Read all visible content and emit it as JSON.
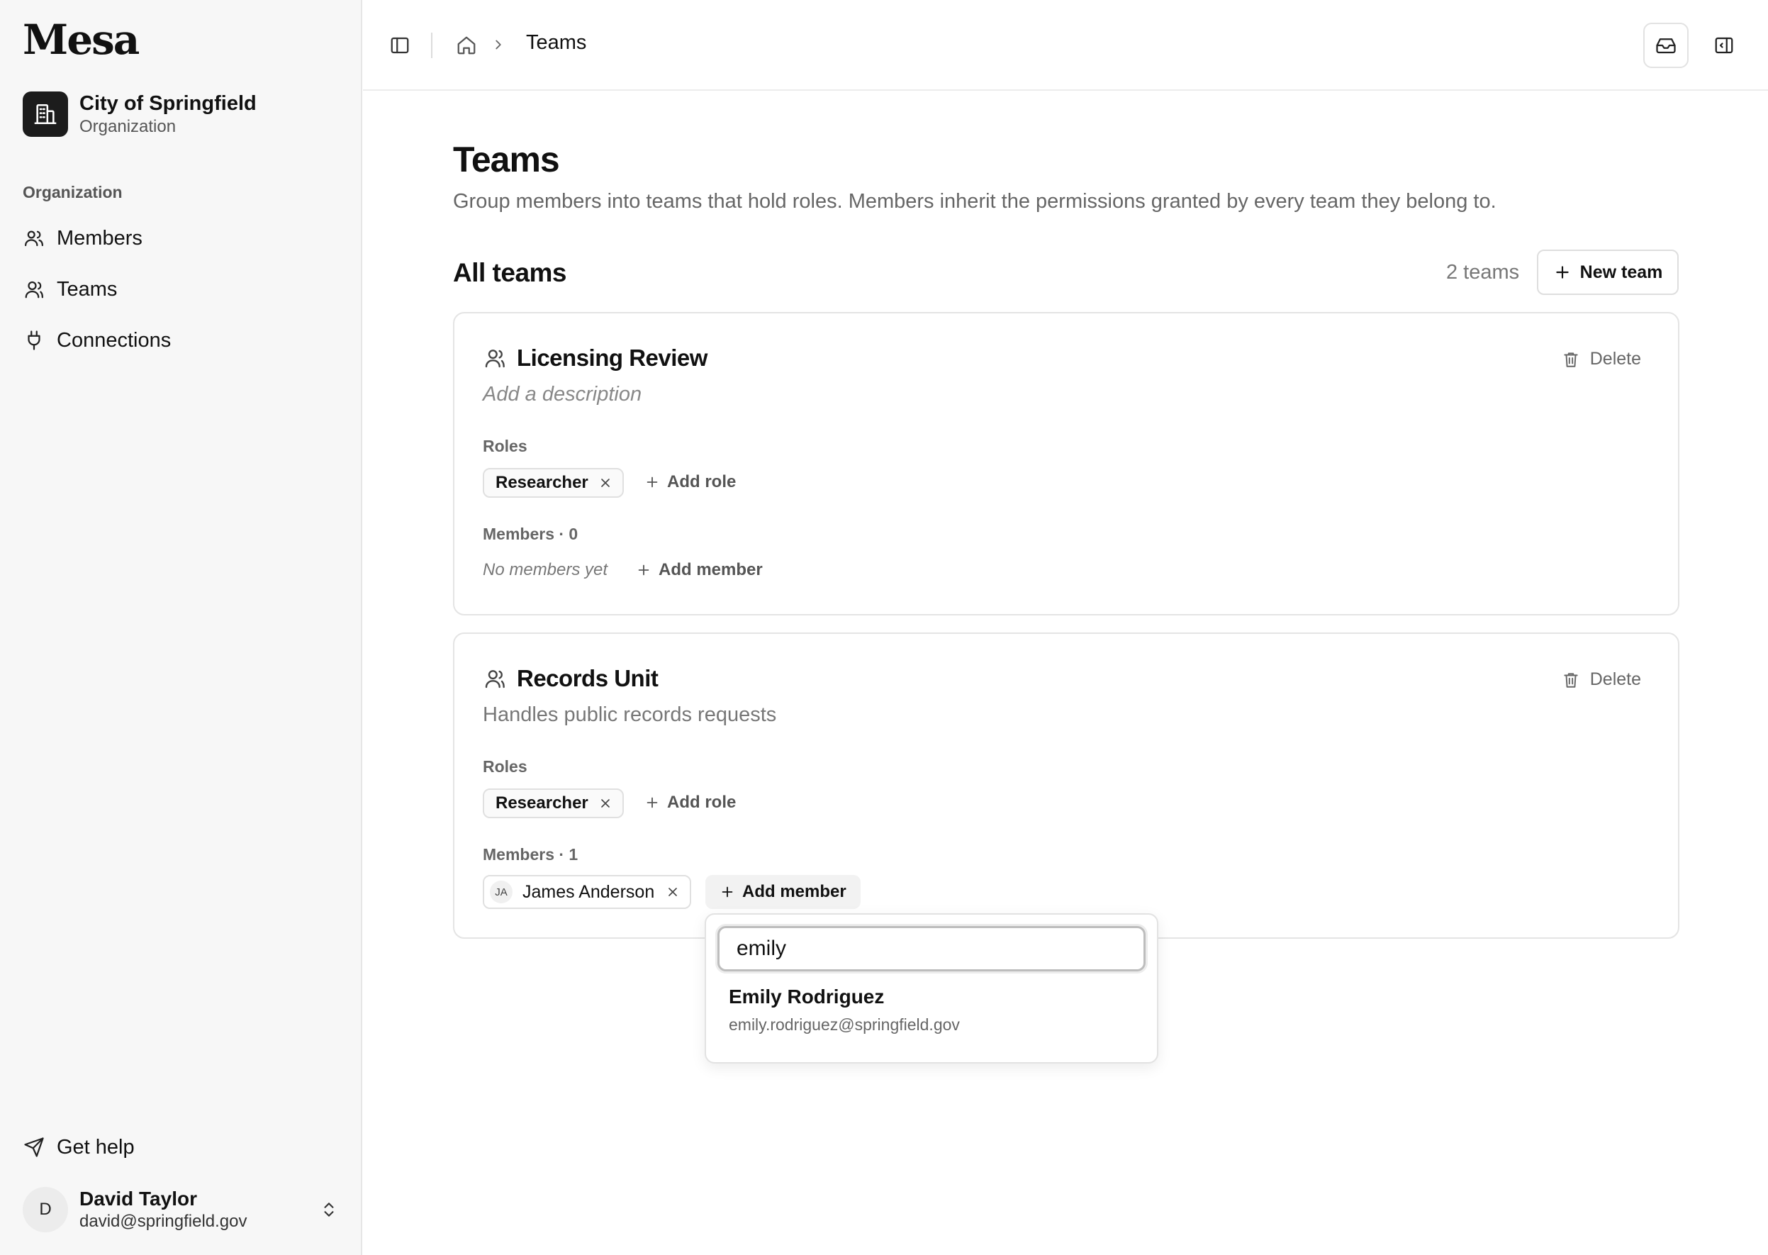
{
  "app": {
    "logo": "Mesa"
  },
  "org": {
    "name": "City of Springfield",
    "subtitle": "Organization"
  },
  "sidebar": {
    "section_label": "Organization",
    "items": [
      {
        "label": "Members",
        "icon": "users-icon"
      },
      {
        "label": "Teams",
        "icon": "user-group-icon"
      },
      {
        "label": "Connections",
        "icon": "plug-icon"
      }
    ],
    "help_label": "Get help"
  },
  "user": {
    "initial": "D",
    "name": "David Taylor",
    "email": "david@springfield.gov"
  },
  "topbar": {
    "breadcrumb_current": "Teams"
  },
  "page": {
    "title": "Teams",
    "description": "Group members into teams that hold roles. Members inherit the permissions granted by every team they belong to.",
    "section_title": "All teams",
    "team_count": "2 teams",
    "new_team_label": "New team"
  },
  "teams": [
    {
      "name": "Licensing Review",
      "description_placeholder": "Add a description",
      "roles_label": "Roles",
      "roles": [
        "Researcher"
      ],
      "add_role_label": "Add role",
      "members_label": "Members · 0",
      "empty_members": "No members yet",
      "add_member_label": "Add member",
      "delete_label": "Delete"
    },
    {
      "name": "Records Unit",
      "description": "Handles public records requests",
      "roles_label": "Roles",
      "roles": [
        "Researcher"
      ],
      "add_role_label": "Add role",
      "members_label": "Members · 1",
      "members": [
        {
          "initials": "JA",
          "name": "James Anderson"
        }
      ],
      "add_member_label": "Add member",
      "delete_label": "Delete"
    }
  ],
  "member_search": {
    "query": "emily",
    "results": [
      {
        "name": "Emily Rodriguez",
        "email": "emily.rodriguez@springfield.gov"
      }
    ]
  }
}
